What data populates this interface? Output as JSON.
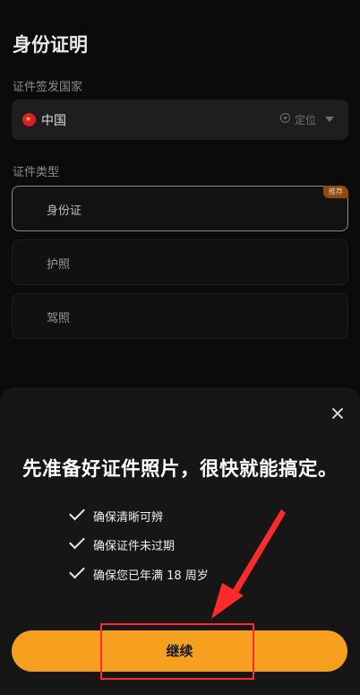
{
  "page": {
    "title": "身份证明",
    "country_section_label": "证件签发国家",
    "country": {
      "name": "中国",
      "locate_label": "定位"
    },
    "doc_type_section_label": "证件类型",
    "doc_types": [
      {
        "label": "身份证",
        "selected": true,
        "badge": "推荐"
      },
      {
        "label": "护照",
        "selected": false
      },
      {
        "label": "驾照",
        "selected": false
      }
    ]
  },
  "sheet": {
    "title": "先准备好证件照片，很快就能搞定。",
    "checklist": [
      "确保清晰可辨",
      "确保证件未过期",
      "确保您已年满 18 周岁"
    ],
    "continue_label": "继续"
  },
  "colors": {
    "accent": "#f79f1f",
    "annotation_red": "#ff2a2a",
    "sheet_bg": "#161616"
  }
}
